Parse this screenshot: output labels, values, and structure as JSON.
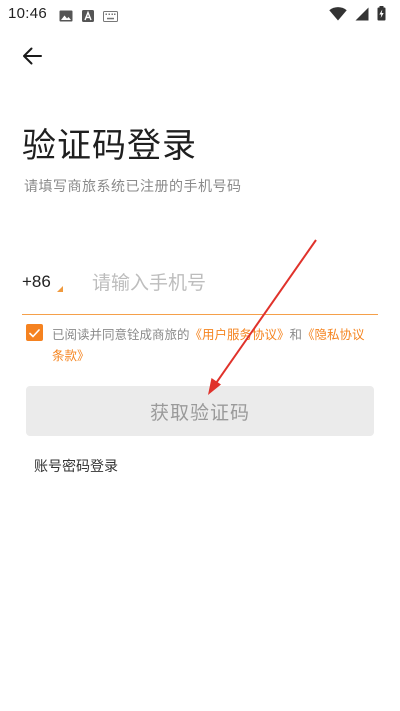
{
  "status_bar": {
    "time": "10:46",
    "icons": [
      "image-icon",
      "a-letter-icon",
      "keyboard-icon",
      "wifi-icon",
      "signal-icon",
      "battery-charging-icon"
    ]
  },
  "header": {
    "back_icon": "arrow-left-icon"
  },
  "page": {
    "title": "验证码登录",
    "subtitle": "请填写商旅系统已注册的手机号码"
  },
  "phone": {
    "country_code": "+86",
    "value": "",
    "placeholder": "请输入手机号"
  },
  "agreement": {
    "checked": true,
    "prefix": "已阅读并同意铨成商旅的",
    "user_agreement": "《用户服务协议》",
    "conjunction": "和",
    "privacy_policy": "《隐私协议条款》"
  },
  "actions": {
    "get_code_label": "获取验证码",
    "password_login_label": "账号密码登录"
  },
  "colors": {
    "accent": "#f58220",
    "annotation": "#e0322b",
    "button_disabled_bg": "#ebebeb"
  }
}
